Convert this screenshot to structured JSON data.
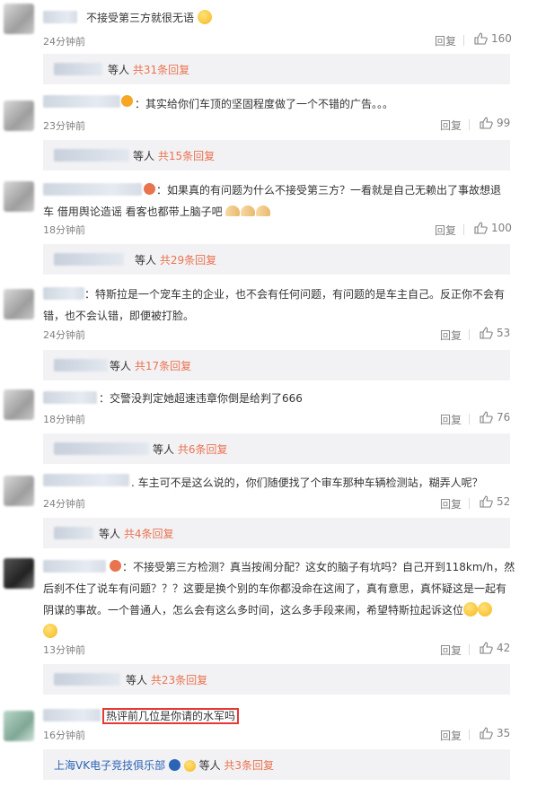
{
  "comments": [
    {
      "text": "不接受第三方就很无语",
      "time": "24分钟前",
      "reply": "回复",
      "likes": "160",
      "sub_suffix": "等人",
      "sub_link": "共31条回复",
      "emoji_tail": "smile-emoji"
    },
    {
      "text": "：其实给你们车顶的坚固程度做了一个不错的广告。。。",
      "time": "23分钟前",
      "reply": "回复",
      "likes": "99",
      "sub_suffix": "等人",
      "sub_link": "共15条回复"
    },
    {
      "text_line1": "：如果真的有问题为什么不接受第三方？一看就是自己无赖出了事故想退",
      "text_line2": "车 借用舆论造谣 看客也都带上脑子吧",
      "time": "18分钟前",
      "reply": "回复",
      "likes": "100",
      "sub_suffix": "等人",
      "sub_link": "共29条回复",
      "emoji_tail": "pray-hands"
    },
    {
      "text_line1": "：特斯拉是一个宠车主的企业，也不会有任何问题，有问题的是车主自己。反正你不会有",
      "text_line2": "错，也不会认错，即便被打脸。",
      "time": "24分钟前",
      "reply": "回复",
      "likes": "53",
      "sub_suffix": "等人",
      "sub_link": "共17条回复"
    },
    {
      "text": "：交警没判定她超速违章你倒是给判了666",
      "time": "18分钟前",
      "reply": "回复",
      "likes": "76",
      "sub_suffix": "等人",
      "sub_link": "共6条回复"
    },
    {
      "text": ". 车主可不是这么说的，你们随便找了个审车那种车辆检测站，糊弄人呢？",
      "time": "24分钟前",
      "reply": "回复",
      "likes": "52",
      "sub_suffix": "等人",
      "sub_link": "共4条回复"
    },
    {
      "text_line1": "：不接受第三方检测？真当按闹分配？这女的脑子有坑吗？自己开到118km/h，然",
      "text_line2": "后刹不住了说车有问题？？？这要是换个别的车你都没命在这闹了，真有意思，真怀疑这是一起有",
      "text_line3": "阴谋的事故。一个普通人，怎么会有这么多时间，这么多手段来闹，希望特斯拉起诉这位",
      "time": "13分钟前",
      "reply": "回复",
      "likes": "42",
      "sub_suffix": "等人",
      "sub_link": "共23条回复"
    },
    {
      "text": "热评前几位是你请的水军吗",
      "time": "16分钟前",
      "reply": "回复",
      "likes": "35",
      "sub_org": "上海VK电子竞技俱乐部",
      "sub_suffix": "等人",
      "sub_link": "共3条回复"
    }
  ],
  "colors": {
    "link": "#eb7350",
    "muted": "#808080",
    "highlight": "#e53935",
    "org": "#2c64b5"
  }
}
